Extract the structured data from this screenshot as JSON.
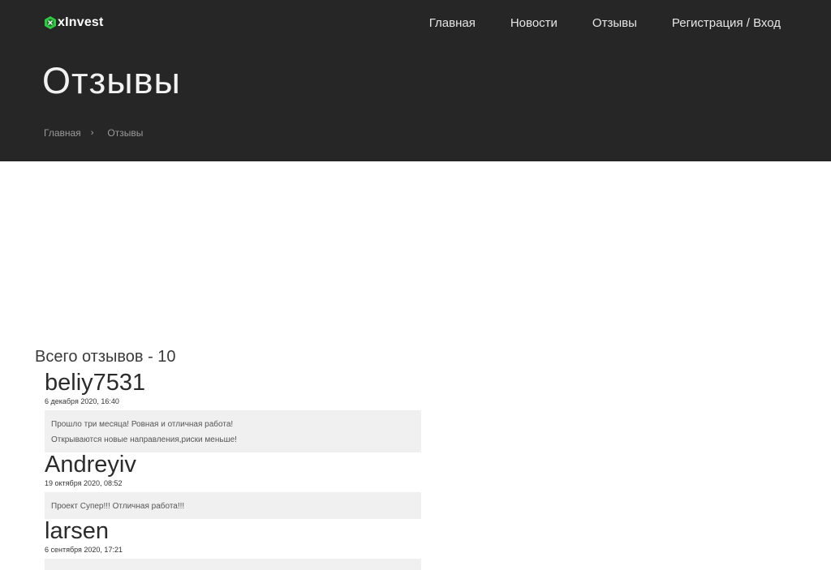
{
  "brand": {
    "name": "xInvest",
    "accent": "#2ecc40"
  },
  "nav": {
    "items": [
      "Главная",
      "Новости",
      "Отзывы",
      "Регистрация / Вход"
    ]
  },
  "page": {
    "title": "Отзывы",
    "breadcrumb": {
      "home": "Главная",
      "separator": "›",
      "current": "Отзывы"
    }
  },
  "reviews": {
    "total_label": "Всего отзывов - 10",
    "items": [
      {
        "author": "beliy7531",
        "date": "6 декабря 2020, 16:40",
        "lines": [
          "Прошло три месяца! Ровная и отличная работа!",
          "Открываются новые направления,риски меньше!"
        ]
      },
      {
        "author": "Andreyiv",
        "date": "19 октября 2020, 08:52",
        "lines": [
          "Проект Супер!!! Отличная работа!!!"
        ]
      },
      {
        "author": "larsen",
        "date": "6 сентября 2020, 17:21",
        "lines": [
          ""
        ]
      }
    ]
  }
}
